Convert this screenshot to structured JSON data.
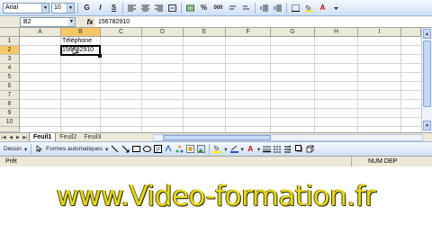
{
  "toolbar": {
    "font_name": "Arial",
    "font_size": "10",
    "bold": "G",
    "italic": "I",
    "underline": "S",
    "percent": "%",
    "thousands": "000",
    "font_color_letter": "A"
  },
  "formula_bar": {
    "name_box": "B2",
    "fx": "fx",
    "formula_value": "156782910"
  },
  "grid": {
    "columns": [
      "A",
      "B",
      "C",
      "D",
      "E",
      "F",
      "G",
      "H",
      "I"
    ],
    "rows": [
      "1",
      "2",
      "3",
      "4",
      "5",
      "6",
      "7",
      "8",
      "9",
      "10"
    ],
    "cells": {
      "B1": "Téléphone",
      "B2": "156782910"
    }
  },
  "sheets": {
    "tabs": [
      "Feuil1",
      "Feuil2",
      "Feuil3"
    ],
    "active": "Feuil1"
  },
  "drawing_toolbar": {
    "dessin": "Dessin",
    "autoshapes": "Formes automatiques",
    "font_color_letter": "A"
  },
  "status_bar": {
    "ready": "Prêt",
    "mode": "NUM DEP"
  },
  "watermark": {
    "text": "www.Video-formation.fr"
  },
  "colors": {
    "selected_header": "#f7c766",
    "watermark": "#e6d81a"
  }
}
